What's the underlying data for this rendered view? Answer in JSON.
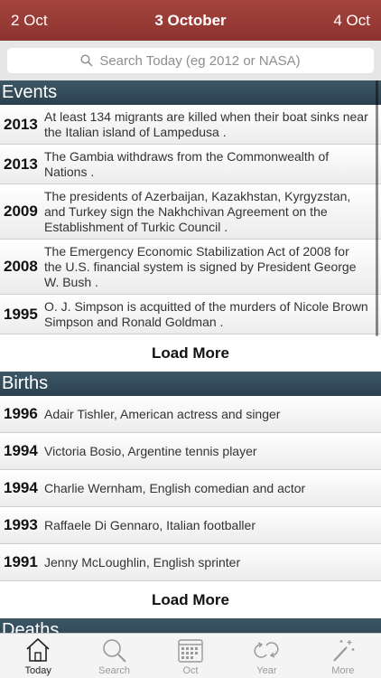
{
  "nav": {
    "prev": "2 Oct",
    "title": "3 October",
    "next": "4 Oct"
  },
  "search": {
    "placeholder": "Search Today (eg 2012 or NASA)"
  },
  "sections": {
    "events": {
      "title": "Events",
      "items": [
        {
          "year": "2013",
          "text": "At least 134 migrants are killed when their boat sinks near the Italian island of Lampedusa ."
        },
        {
          "year": "2013",
          "text": "The Gambia withdraws from the Commonwealth of Nations ."
        },
        {
          "year": "2009",
          "text": "The presidents of Azerbaijan, Kazakhstan, Kyrgyzstan, and Turkey sign the Nakhchivan Agreement on the Establishment of Turkic Council ."
        },
        {
          "year": "2008",
          "text": "The Emergency Economic Stabilization Act of 2008 for the U.S. financial system is signed by President George W. Bush ."
        },
        {
          "year": "1995",
          "text": "O. J. Simpson is acquitted of the murders of Nicole Brown Simpson and Ronald Goldman ."
        }
      ],
      "load_more": "Load More"
    },
    "births": {
      "title": "Births",
      "items": [
        {
          "year": "1996",
          "text": "Adair Tishler, American actress and singer"
        },
        {
          "year": "1994",
          "text": "Victoria Bosio, Argentine tennis player"
        },
        {
          "year": "1994",
          "text": "Charlie Wernham, English comedian and actor"
        },
        {
          "year": "1993",
          "text": "Raffaele Di Gennaro, Italian footballer"
        },
        {
          "year": "1991",
          "text": "Jenny McLoughlin, English sprinter"
        }
      ],
      "load_more": "Load More"
    },
    "deaths": {
      "title": "Deaths"
    }
  },
  "tabs": [
    {
      "label": "Today",
      "icon": "house-icon",
      "active": true
    },
    {
      "label": "Search",
      "icon": "search-icon",
      "active": false
    },
    {
      "label": "Oct",
      "icon": "calendar-icon",
      "active": false
    },
    {
      "label": "Year",
      "icon": "cycle-icon",
      "active": false
    },
    {
      "label": "More",
      "icon": "magic-wand-icon",
      "active": false
    }
  ],
  "colors": {
    "nav": "#99403a",
    "section": "#34505f",
    "tab_active": "#222222",
    "tab_inactive": "#9a9a9a"
  }
}
